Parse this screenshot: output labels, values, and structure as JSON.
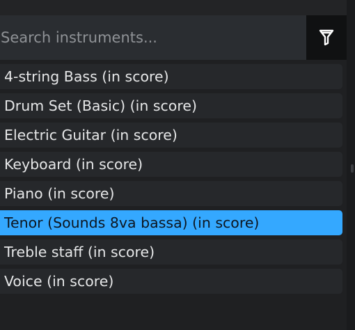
{
  "search": {
    "placeholder": "Search instruments...",
    "value": ""
  },
  "filter_button": {
    "icon": "filter-icon"
  },
  "instruments": [
    {
      "label": "4-string Bass (in score)",
      "selected": false
    },
    {
      "label": "Drum Set (Basic) (in score)",
      "selected": false
    },
    {
      "label": "Electric Guitar (in score)",
      "selected": false
    },
    {
      "label": "Keyboard (in score)",
      "selected": false
    },
    {
      "label": "Piano (in score)",
      "selected": false
    },
    {
      "label": "Tenor (Sounds 8va bassa) (in score)",
      "selected": true
    },
    {
      "label": "Treble staff (in score)",
      "selected": false
    },
    {
      "label": "Voice (in score)",
      "selected": false
    }
  ],
  "colors": {
    "selection": "#34a8ff",
    "row": "#26282b",
    "search_bg": "#2a2d31"
  }
}
